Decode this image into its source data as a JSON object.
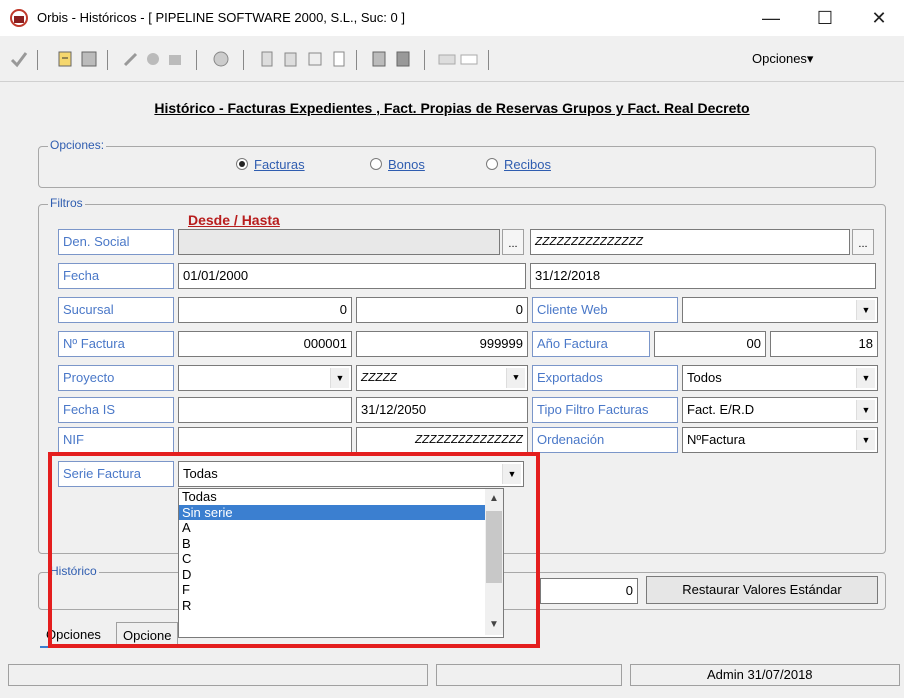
{
  "window": {
    "title": "Orbis - Históricos - [ PIPELINE SOFTWARE 2000, S.L.,  Suc: 0 ]",
    "minimize": "—",
    "maximize": "☐",
    "close": "✕"
  },
  "toolbar": {
    "options_label": "Opciones▾"
  },
  "heading": "Histórico - Facturas Expedientes , Fact. Propias de Reservas Grupos y Fact. Real Decreto",
  "opciones": {
    "label": "Opciones:",
    "radios": [
      "Facturas",
      "Bonos",
      "Recibos"
    ],
    "selected": "Facturas"
  },
  "filtros": {
    "label": "Filtros",
    "desde_hasta": "Desde / Hasta",
    "den_social": {
      "label": "Den. Social",
      "from": "",
      "to": "ZZZZZZZZZZZZZZZ"
    },
    "fecha": {
      "label": "Fecha",
      "from": "01/01/2000",
      "to": "31/12/2018"
    },
    "sucursal": {
      "label": "Sucursal",
      "from": "0",
      "to": "0"
    },
    "cliente_web": {
      "label": "Cliente Web",
      "value": ""
    },
    "n_factura": {
      "label": "Nº Factura",
      "from": "000001",
      "to": "999999"
    },
    "ano_factura": {
      "label": "Año Factura",
      "from": "00",
      "to": "18"
    },
    "proyecto": {
      "label": "Proyecto",
      "from": "",
      "to": "ZZZZZ"
    },
    "exportados": {
      "label": "Exportados",
      "value": "Todos"
    },
    "fecha_is": {
      "label": "Fecha IS",
      "from": "",
      "to": "31/12/2050"
    },
    "tipo_filtro": {
      "label": "Tipo Filtro Facturas",
      "value": "Fact. E/R.D"
    },
    "nif": {
      "label": "NIF",
      "from": "",
      "to": "ZZZZZZZZZZZZZZZ"
    },
    "ordenacion": {
      "label": "Ordenación",
      "value": "NºFactura"
    },
    "serie_factura": {
      "label": "Serie Factura",
      "value": "Todas",
      "options": [
        "Todas",
        "Sin serie",
        "A",
        "B",
        "C",
        "D",
        "F",
        "R"
      ],
      "highlighted": "Sin serie"
    }
  },
  "historico": {
    "label": "Histórico",
    "value": "0",
    "restore_button": "Restaurar Valores Estándar"
  },
  "tabs": [
    "Opciones",
    "Opcione"
  ],
  "status": {
    "right": "Admin 31/07/2018"
  },
  "colors": {
    "label_text": "#4a78c8",
    "highlight": "#3b7fd0",
    "red_frame": "#e41e1e",
    "desde_hasta": "#b81d1d"
  }
}
